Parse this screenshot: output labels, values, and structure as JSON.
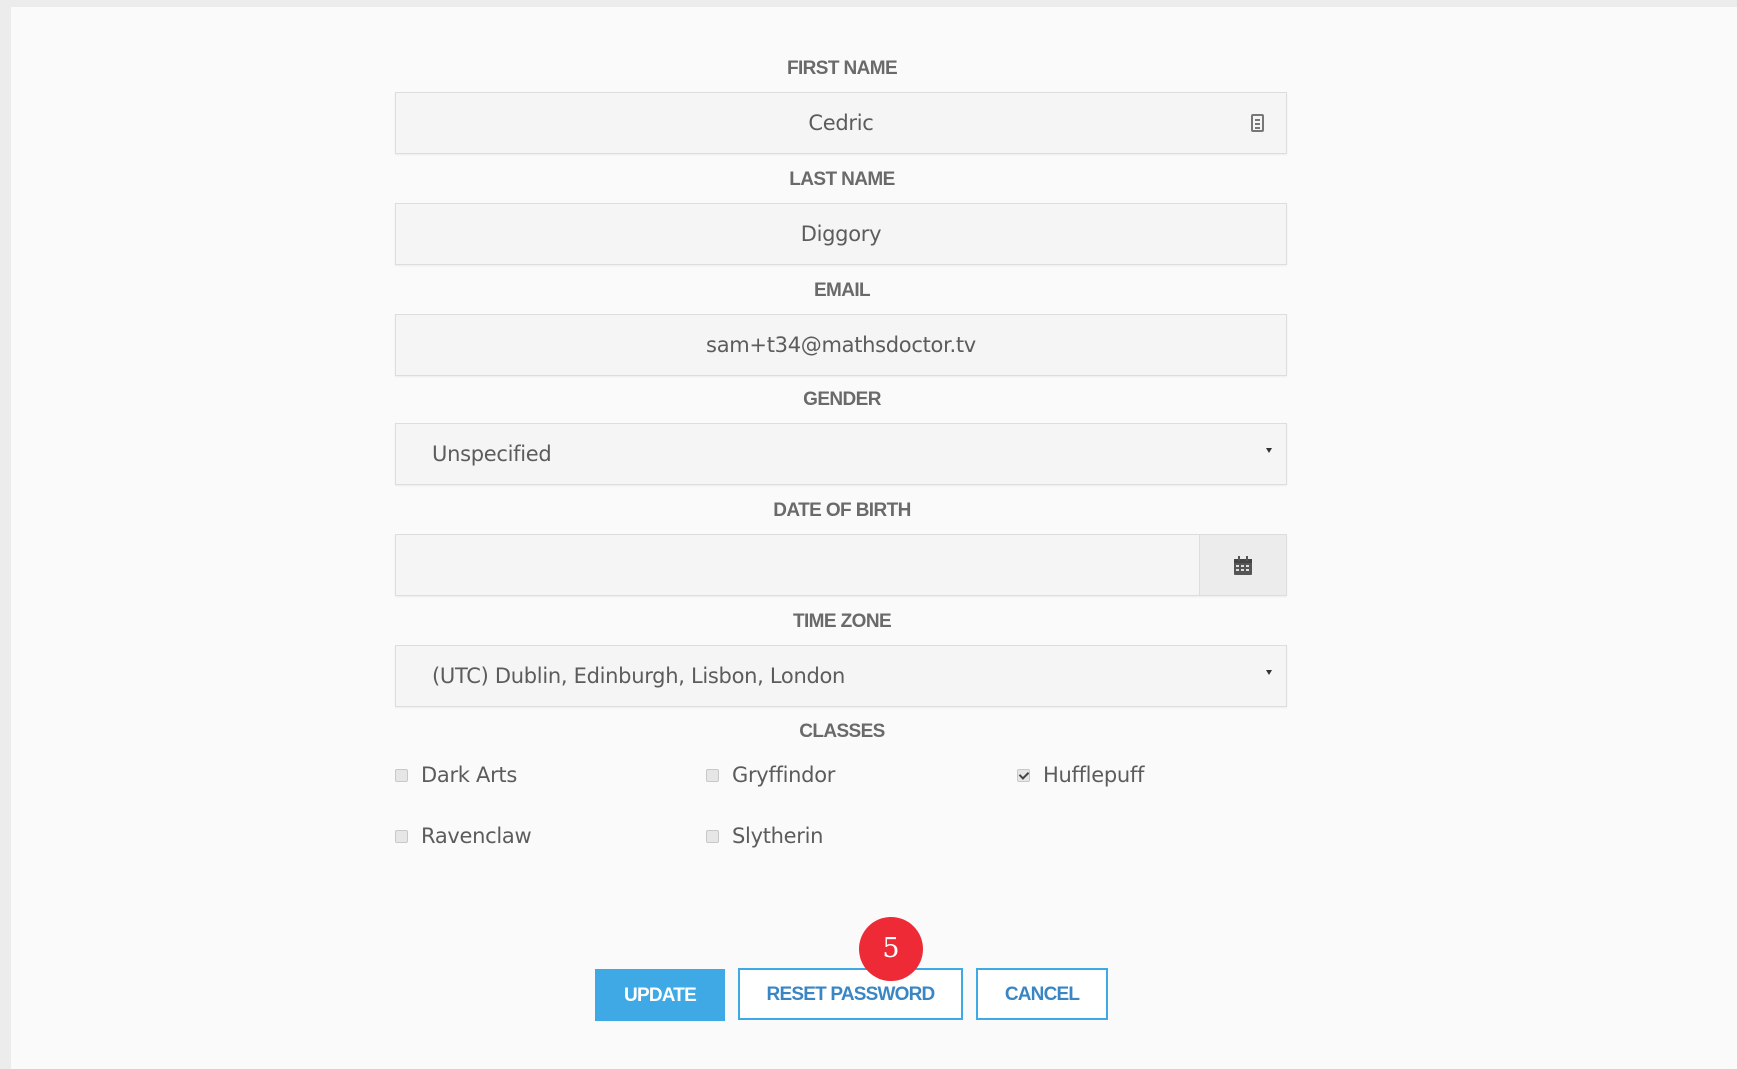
{
  "form": {
    "first_name": {
      "label": "FIRST NAME",
      "value": "Cedric"
    },
    "last_name": {
      "label": "LAST NAME",
      "value": "Diggory"
    },
    "email": {
      "label": "EMAIL",
      "value": "sam+t34@mathsdoctor.tv"
    },
    "gender": {
      "label": "GENDER",
      "value": "Unspecified"
    },
    "date_of_birth": {
      "label": "DATE OF BIRTH",
      "value": "",
      "icon": "calendar-icon"
    },
    "time_zone": {
      "label": "TIME ZONE",
      "value": "(UTC) Dublin, Edinburgh, Lisbon, London"
    },
    "classes": {
      "label": "CLASSES",
      "items": [
        {
          "label": "Dark Arts",
          "checked": false
        },
        {
          "label": "Gryffindor",
          "checked": false
        },
        {
          "label": "Hufflepuff",
          "checked": true
        },
        {
          "label": "Ravenclaw",
          "checked": false
        },
        {
          "label": "Slytherin",
          "checked": false
        }
      ]
    }
  },
  "buttons": {
    "update": "UPDATE",
    "reset_password": "RESET PASSWORD",
    "cancel": "CANCEL"
  },
  "annotation": {
    "step": "5",
    "color": "#ee2a36"
  },
  "colors": {
    "primary": "#3fa9e6",
    "outline_text": "#3a86c4",
    "field_bg": "#f5f5f5"
  }
}
